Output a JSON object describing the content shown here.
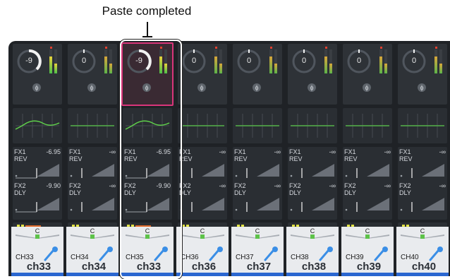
{
  "callout": {
    "text": "Paste completed"
  },
  "channels": [
    {
      "id": "CH33",
      "name": "ch33",
      "gain": "-9",
      "fx1": {
        "label": "FX1",
        "type": "REV",
        "value": "-6.95"
      },
      "fx2": {
        "label": "FX2",
        "type": "DLY",
        "value": "-9.90"
      },
      "pan": "C",
      "selected": false,
      "eq_curve": true
    },
    {
      "id": "CH34",
      "name": "ch34",
      "gain": "0",
      "fx1": {
        "label": "FX1",
        "type": "REV",
        "value": "-∞"
      },
      "fx2": {
        "label": "FX2",
        "type": "DLY",
        "value": "-∞"
      },
      "pan": "C",
      "selected": false,
      "eq_curve": false
    },
    {
      "id": "CH35",
      "name": "ch33",
      "gain": "-9",
      "fx1": {
        "label": "FX1",
        "type": "REV",
        "value": "-6.95"
      },
      "fx2": {
        "label": "FX2",
        "type": "DLY",
        "value": "-9.90"
      },
      "pan": "C",
      "selected": true,
      "eq_curve": true
    },
    {
      "id": "CH36",
      "name": "ch36",
      "gain": "0",
      "fx1": {
        "label": "FX1",
        "type": "REV",
        "value": "-∞"
      },
      "fx2": {
        "label": "FX2",
        "type": "DLY",
        "value": "-∞"
      },
      "pan": "C",
      "selected": false,
      "eq_curve": false
    },
    {
      "id": "CH37",
      "name": "ch37",
      "gain": "0",
      "fx1": {
        "label": "FX1",
        "type": "REV",
        "value": "-∞"
      },
      "fx2": {
        "label": "FX2",
        "type": "DLY",
        "value": "-∞"
      },
      "pan": "C",
      "selected": false,
      "eq_curve": false
    },
    {
      "id": "CH38",
      "name": "ch38",
      "gain": "0",
      "fx1": {
        "label": "FX1",
        "type": "REV",
        "value": "-∞"
      },
      "fx2": {
        "label": "FX2",
        "type": "DLY",
        "value": "-∞"
      },
      "pan": "C",
      "selected": false,
      "eq_curve": false
    },
    {
      "id": "CH39",
      "name": "ch39",
      "gain": "0",
      "fx1": {
        "label": "FX1",
        "type": "REV",
        "value": "-∞"
      },
      "fx2": {
        "label": "FX2",
        "type": "DLY",
        "value": "-∞"
      },
      "pan": "C",
      "selected": false,
      "eq_curve": false
    },
    {
      "id": "CH40",
      "name": "ch40",
      "gain": "0",
      "fx1": {
        "label": "FX1",
        "type": "REV",
        "value": "-∞"
      },
      "fx2": {
        "label": "FX2",
        "type": "DLY",
        "value": "-∞"
      },
      "pan": "C",
      "selected": false,
      "eq_curve": false
    }
  ],
  "phase_symbol": "ϕ",
  "colors": {
    "selected_border": "#d9357a",
    "eq_curve": "#5fd14a",
    "eq_flat": "#55b24a",
    "channel_bar": "#2a66d0",
    "mic_blue": "#3a8ee6"
  }
}
